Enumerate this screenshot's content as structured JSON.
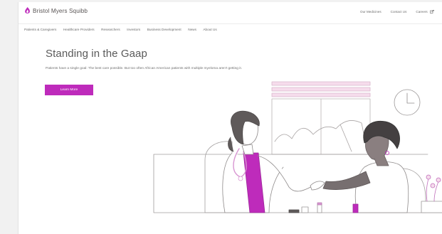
{
  "brand": {
    "name": "Bristol Myers Squibb",
    "accent_color": "#be2bbb",
    "logo_icon": "bms-flame-icon"
  },
  "utility_nav": {
    "items": [
      "Our Medicines",
      "Contact Us",
      "Careers"
    ],
    "external_icon": "external-link-icon"
  },
  "main_nav": {
    "items": [
      "Patients & Caregivers",
      "Healthcare Providers",
      "Researchers",
      "Investors",
      "Business Development",
      "News",
      "About Us"
    ]
  },
  "hero": {
    "title": "Standing in the Gaap",
    "body": "Patients have a single goal: The best care possible. But too often African American patients with multiple myeloma aren't getting it.",
    "cta_label": "Learn More"
  },
  "illustration": {
    "subject": "doctor-patient-handshake-illustration",
    "accent_colors": [
      "#be2bbb",
      "#d896d2",
      "#f6dcec"
    ]
  }
}
